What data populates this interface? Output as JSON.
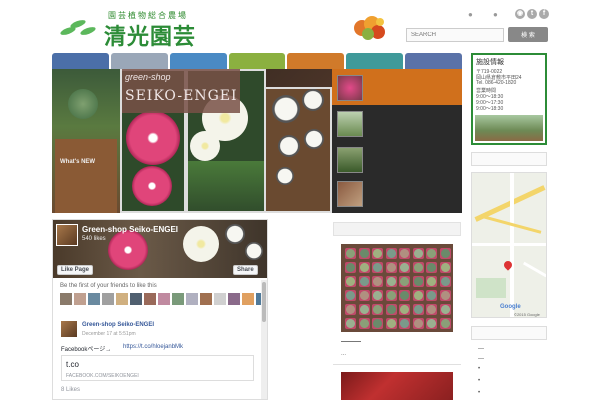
{
  "header": {
    "logo_sub": "園芸植物総合農場",
    "logo_main": "清光園芸",
    "nav_dots": "● ● ●",
    "social": [
      "rss-icon",
      "twitter-icon",
      "facebook-icon"
    ],
    "search_placeholder": "SEARCH",
    "search_button": "検 索"
  },
  "nav": {
    "colors": [
      "#4b6fa8",
      "#9aa7b8",
      "#4a8ac4",
      "#8bb040",
      "#d07a2a",
      "#3f9a9a",
      "#5a72a8"
    ]
  },
  "slider": {
    "shop_title_1": "green-shop",
    "shop_title_2": "SEIKO-ENGEI",
    "crate_label": "What's NEW"
  },
  "sidebar": {
    "facility_title": "施設情報",
    "facility_lines": [
      "〒719-0022",
      "岡山県倉敷市平田24",
      "Tel. 086-420-1820",
      "営業時間",
      "9:00〜18:30",
      "9:00〜17:30",
      "9:00〜18:30"
    ],
    "map_google": "Google",
    "map_copy": "©2015 Google",
    "links": [
      "—",
      "—",
      "•",
      "•",
      "•"
    ]
  },
  "facebook": {
    "page_name": "Green-shop Seiko-ENGEI",
    "likes": "540 likes",
    "like_button": "Like Page",
    "share_button": "Share",
    "friends_text": "Be the first of your friends to like this",
    "post_name": "Green-shop Seiko-ENGEI",
    "post_date": "December 17 at 5:51pm",
    "post_text": "Facebookページ→",
    "post_link": "https://t.co/hloejanbMk",
    "card_title": "t.co",
    "card_url": "FACEBOOK.COM/SEIKOENGEI",
    "card_likes": "8 Likes"
  },
  "center": {
    "dash": "—",
    "ellipsis": "..."
  }
}
